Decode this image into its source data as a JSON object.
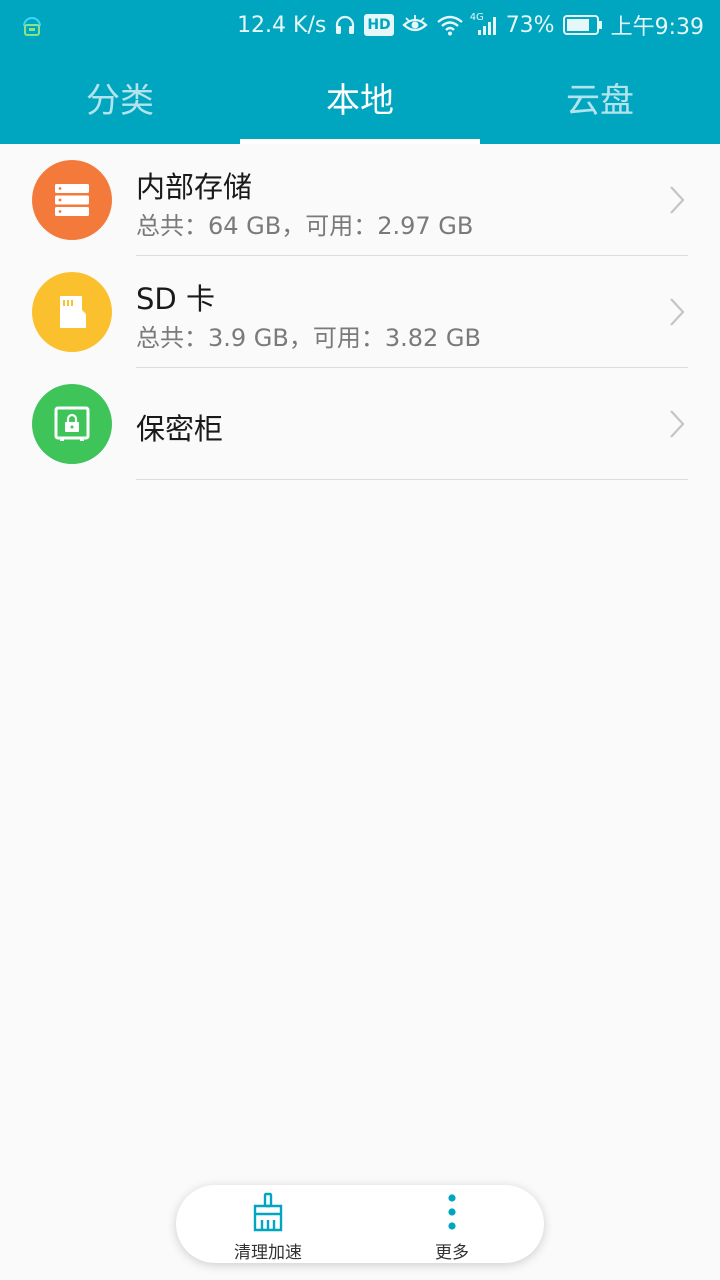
{
  "colors": {
    "header_bg": "#00a5bf",
    "internal_storage": "#f47a3b",
    "sd_card": "#fbc02d",
    "vault": "#3fc45a",
    "accent": "#00a5bf"
  },
  "status_bar": {
    "network_speed": "12.4 K/s",
    "hd_badge": "HD",
    "signal_type": "4G",
    "battery": "73%",
    "time": "上午9:39"
  },
  "tabs": [
    {
      "label": "分类",
      "active": false
    },
    {
      "label": "本地",
      "active": true
    },
    {
      "label": "云盘",
      "active": false
    }
  ],
  "storage_items": [
    {
      "title": "内部存储",
      "subtitle": "总共：64 GB，可用：2.97 GB",
      "icon": "server-storage-icon"
    },
    {
      "title": "SD 卡",
      "subtitle": "总共：3.9 GB，可用：3.82 GB",
      "icon": "sd-card-icon"
    },
    {
      "title": "保密柜",
      "subtitle": "",
      "icon": "safe-lock-icon"
    }
  ],
  "bottom_bar": {
    "clean_label": "清理加速",
    "more_label": "更多"
  }
}
